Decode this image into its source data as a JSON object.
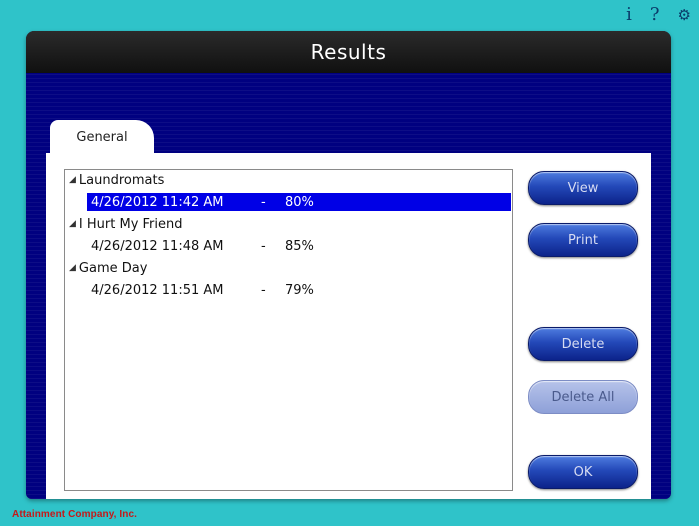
{
  "top_icons": {
    "info": "i",
    "help": "?",
    "settings": "⚙"
  },
  "window": {
    "title": "Results"
  },
  "tabs": [
    {
      "label": "General"
    }
  ],
  "tree": [
    {
      "label": "Laundromats",
      "children": [
        {
          "datetime": "4/26/2012 11:42 AM",
          "sep": "-",
          "score": "80%",
          "selected": true
        }
      ]
    },
    {
      "label": "I Hurt My Friend",
      "children": [
        {
          "datetime": "4/26/2012 11:48 AM",
          "sep": "-",
          "score": "85%",
          "selected": false
        }
      ]
    },
    {
      "label": "Game Day",
      "children": [
        {
          "datetime": "4/26/2012 11:51 AM",
          "sep": "-",
          "score": "79%",
          "selected": false
        }
      ]
    }
  ],
  "buttons": {
    "view": "View",
    "print": "Print",
    "delete": "Delete",
    "delete_all": "Delete All",
    "ok": "OK"
  },
  "footer": {
    "company": "Attainment Company, Inc."
  },
  "colors": {
    "background": "#2fc3c9",
    "selection": "#0000e6",
    "button": "#2348b8",
    "brand": "#c41a1a"
  }
}
